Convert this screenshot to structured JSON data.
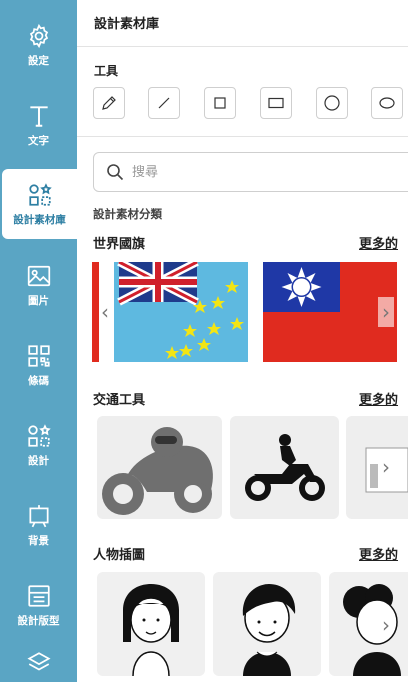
{
  "rail": {
    "items": [
      {
        "label": "設定",
        "icon": "gear-icon"
      },
      {
        "label": "文字",
        "icon": "text-t-icon"
      },
      {
        "label": "設計素材庫",
        "icon": "shapes-icon"
      },
      {
        "label": "圖片",
        "icon": "image-icon"
      },
      {
        "label": "條碼",
        "icon": "qr-code-icon"
      },
      {
        "label": "設計",
        "icon": "design-shapes-icon"
      },
      {
        "label": "背景",
        "icon": "background-frame-icon"
      },
      {
        "label": "設計版型",
        "icon": "layout-template-icon"
      }
    ],
    "active_index": 2,
    "colors": {
      "background": "#5aa5c4",
      "active_text": "#2e7fa3"
    }
  },
  "panel": {
    "title": "設計素材庫",
    "tools": {
      "label": "工具",
      "items": [
        "pencil-icon",
        "line-icon",
        "square-icon",
        "rectangle-icon",
        "circle-icon",
        "ellipse-icon"
      ]
    },
    "search": {
      "placeholder": "搜尋"
    },
    "category_label": "設計素材分類",
    "sections": [
      {
        "title": "世界國旗",
        "more": "更多的"
      },
      {
        "title": "交通工具",
        "more": "更多的"
      },
      {
        "title": "人物插圖",
        "more": "更多的"
      }
    ]
  }
}
